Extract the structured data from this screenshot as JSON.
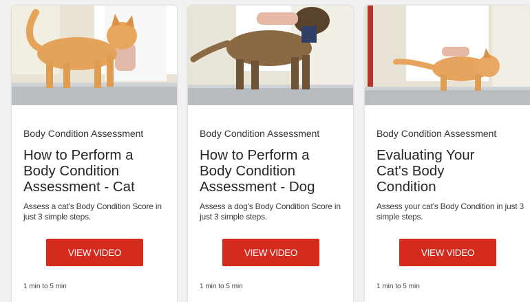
{
  "cards": [
    {
      "category": "Body Condition Assessment",
      "title": "How to Perform a\nBody Condition\nAssessment - Cat",
      "description": "Assess a cat's Body Condition Score in just 3 simple steps.",
      "button_label": "VIEW VIDEO",
      "duration": "1 min to 5 min"
    },
    {
      "category": "Body Condition Assessment",
      "title": "How to Perform a\nBody Condition\nAssessment - Dog",
      "description": "Assess a dog's Body Condition Score in just 3 simple steps.",
      "button_label": "VIEW VIDEO",
      "duration": "1 min to 5 min"
    },
    {
      "category": "Body Condition Assessment",
      "title": "Evaluating Your\nCat's Body\nCondition",
      "description": "Assess your cat's Body Condition in just 3 simple steps.",
      "button_label": "VIEW VIDEO",
      "duration": "1 min to 5 min"
    }
  ],
  "colors": {
    "button": "#d52b1e",
    "card": "#ffffff",
    "page": "#f1f1f1"
  }
}
